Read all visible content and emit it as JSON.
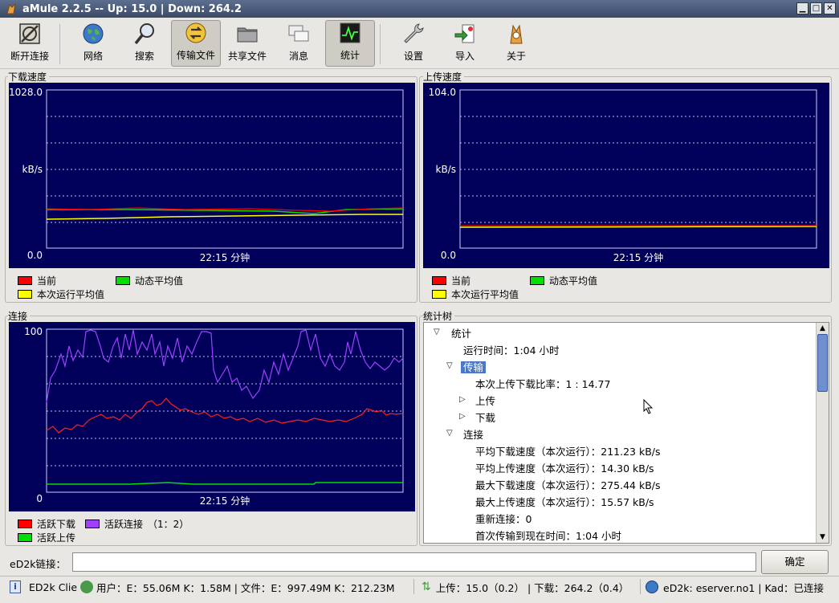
{
  "window": {
    "title": "aMule 2.2.5 -- Up: 15.0 | Down: 264.2"
  },
  "toolbar": [
    {
      "label": "断开连接",
      "icon": "disconnect-icon"
    },
    {
      "label": "网络",
      "icon": "globe-icon"
    },
    {
      "label": "搜索",
      "icon": "search-icon"
    },
    {
      "label": "传输文件",
      "icon": "transfer-icon",
      "active": true
    },
    {
      "label": "共享文件",
      "icon": "folder-icon"
    },
    {
      "label": "消息",
      "icon": "messages-icon"
    },
    {
      "label": "统计",
      "icon": "statistics-icon",
      "active": true
    },
    {
      "label": "设置",
      "icon": "wrench-icon"
    },
    {
      "label": "导入",
      "icon": "import-icon"
    },
    {
      "label": "关于",
      "icon": "about-icon"
    }
  ],
  "download_panel": {
    "title": "下载速度",
    "ymax": "1028.0",
    "ymin": "0.0",
    "unit": "kB/s",
    "time": "22:15 分钟",
    "legend": [
      "当前",
      "动态平均值",
      "本次运行平均值"
    ]
  },
  "upload_panel": {
    "title": "上传速度",
    "ymax": "104.0",
    "ymin": "0.0",
    "unit": "kB/s",
    "time": "22:15 分钟",
    "legend": [
      "当前",
      "动态平均值",
      "本次运行平均值"
    ]
  },
  "connections_panel": {
    "title": "连接",
    "ymax": "100",
    "ymin": "0",
    "time": "22:15 分钟",
    "legend": [
      "活跃下载",
      "活跃连接",
      "（1：2）",
      "活跃上传"
    ]
  },
  "colors": {
    "current": "#ff0000",
    "dynamic": "#00e000",
    "session": "#ffff00",
    "connections": "#a040ff",
    "graph_bg": "#00005a"
  },
  "stats_tree": {
    "title": "统计树",
    "rows": [
      {
        "text": "统计",
        "level": 0,
        "toggle": "open"
      },
      {
        "text": "运行时间：1:04 小时",
        "level": 1
      },
      {
        "text": "传输",
        "level": 1,
        "toggle": "open",
        "selected": true
      },
      {
        "text": "本次上传下载比率：1 : 14.77",
        "level": 2
      },
      {
        "text": "上传",
        "level": 2,
        "toggle": "closed"
      },
      {
        "text": "下载",
        "level": 2,
        "toggle": "closed"
      },
      {
        "text": "连接",
        "level": 1,
        "toggle": "open"
      },
      {
        "text": "平均下载速度（本次运行）：211.23 kB/s",
        "level": 2
      },
      {
        "text": "平均上传速度（本次运行）：14.30 kB/s",
        "level": 2
      },
      {
        "text": "最大下载速度（本次运行）：275.44 kB/s",
        "level": 2
      },
      {
        "text": "最大上传速度（本次运行）：15.57 kB/s",
        "level": 2
      },
      {
        "text": "重新连接：0",
        "level": 2
      },
      {
        "text": "首次传输到现在时间：1:04 小时",
        "level": 2
      }
    ]
  },
  "ed2k": {
    "label": "eD2k链接：",
    "value": "",
    "button": "确定"
  },
  "status": {
    "client": "ED2k Clie",
    "users": "用户：E：55.06M K：1.58M | 文件：E：997.49M K：212.23M",
    "up": "上传：15.0（0.2）",
    "down": "| 下载：264.2（0.4）",
    "server": "eD2k: eserver.no1 | Kad：已连接"
  }
}
